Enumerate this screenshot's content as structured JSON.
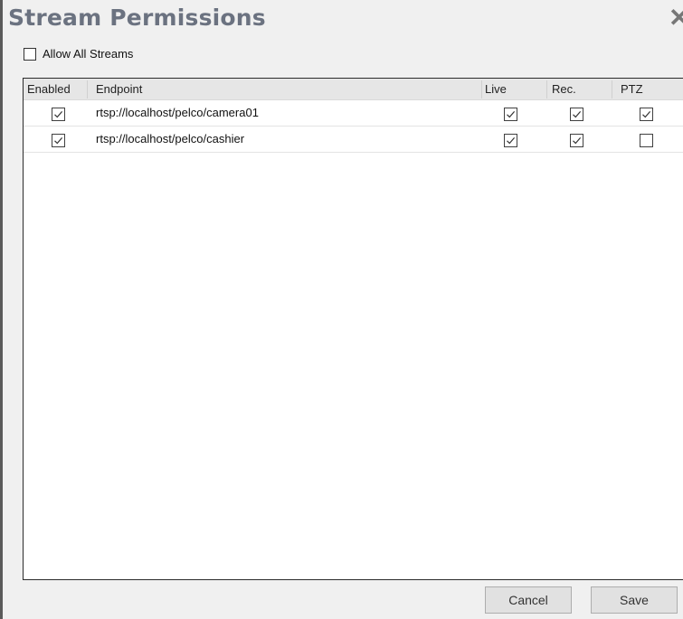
{
  "dialog": {
    "title": "Stream Permissions",
    "close_glyph": "✕"
  },
  "allow_all": {
    "label": "Allow All Streams",
    "checked": false
  },
  "grid": {
    "columns": [
      "Enabled",
      "Endpoint",
      "Live",
      "Rec.",
      "PTZ"
    ],
    "rows": [
      {
        "enabled": true,
        "endpoint": "rtsp://localhost/pelco/camera01",
        "live": true,
        "rec": true,
        "ptz": true
      },
      {
        "enabled": true,
        "endpoint": "rtsp://localhost/pelco/cashier",
        "live": true,
        "rec": true,
        "ptz": false
      }
    ]
  },
  "buttons": {
    "cancel": "Cancel",
    "save": "Save"
  },
  "icons": {
    "close": "close-icon",
    "check": "checkmark-icon"
  }
}
